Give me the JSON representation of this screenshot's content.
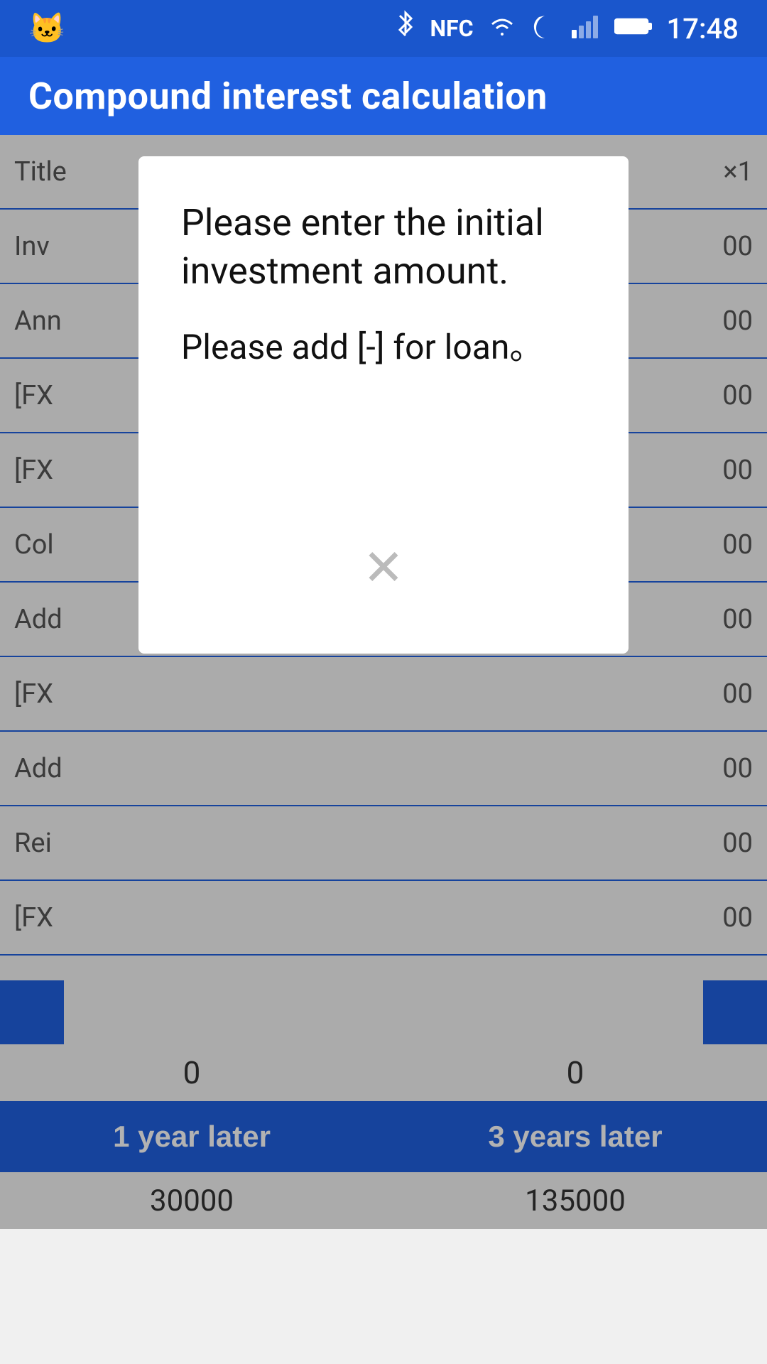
{
  "statusBar": {
    "time": "17:48",
    "catIcon": "🐱",
    "icons": [
      "bluetooth",
      "nfc",
      "moon",
      "no-sim",
      "signal",
      "battery"
    ]
  },
  "header": {
    "title": "Compound interest calculation"
  },
  "tableRows": [
    {
      "label": "Title",
      "value": "×1"
    },
    {
      "label": "Inv",
      "value": "00"
    },
    {
      "label": "Ann",
      "value": "00"
    },
    {
      "label": "[FX",
      "value": "00"
    },
    {
      "label": "[FX",
      "value": "00"
    },
    {
      "label": "Col",
      "value": "00"
    },
    {
      "label": "Add",
      "value": "00"
    },
    {
      "label": "[FX",
      "value": "00"
    },
    {
      "label": "Add",
      "value": "00"
    },
    {
      "label": "Rei",
      "value": "00"
    },
    {
      "label": "[FX",
      "value": "00"
    }
  ],
  "results": {
    "oneYear": {
      "value": "0",
      "label": "1 year later",
      "amount": "30000"
    },
    "threeYears": {
      "value": "0",
      "label": "3 years later",
      "amount": "135000"
    }
  },
  "modal": {
    "title": "Please enter the initial investment amount.",
    "subtitle": "Please add [-] for loan。",
    "closeLabel": "×"
  }
}
